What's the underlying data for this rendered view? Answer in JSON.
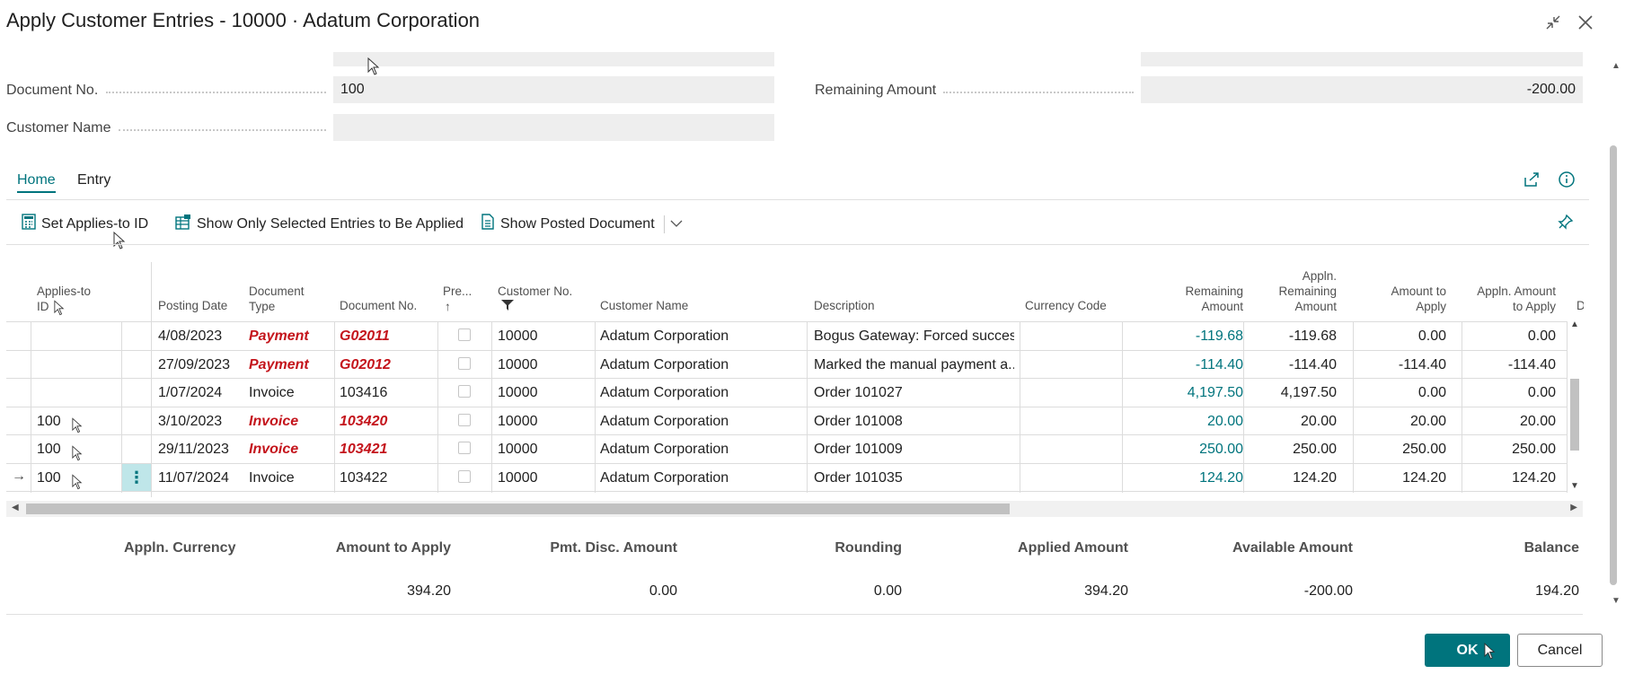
{
  "window": {
    "title": "Apply Customer Entries - 10000 · Adatum Corporation"
  },
  "header_fields": {
    "document_no_label": "Document No.",
    "document_no_value": "100",
    "customer_name_label": "Customer Name",
    "customer_name_value": "",
    "remaining_amount_label": "Remaining Amount",
    "remaining_amount_value": "-200.00"
  },
  "tabs": [
    {
      "label": "Home",
      "active": true
    },
    {
      "label": "Entry",
      "active": false
    }
  ],
  "actions": {
    "set_applies_to_id": "Set Applies-to ID",
    "show_only_selected": "Show Only Selected Entries to Be Applied",
    "show_posted_document": "Show Posted Document"
  },
  "columns": {
    "applies_to_id": [
      "Applies-to",
      "ID"
    ],
    "posting_date": "Posting Date",
    "document_type": [
      "Document",
      "Type"
    ],
    "document_no": "Document No.",
    "pre": "Pre...",
    "customer_no": "Customer No.",
    "customer_name": "Customer Name",
    "description": "Description",
    "currency_code": "Currency Code",
    "remaining_amount": [
      "Remaining",
      "Amount"
    ],
    "appln_remaining_amount": [
      "Appln.",
      "Remaining",
      "Amount"
    ],
    "amount_to_apply": [
      "Amount to",
      "Apply"
    ],
    "appln_amount_to_apply": [
      "Appln. Amount",
      "to Apply"
    ],
    "d": "D"
  },
  "rows": [
    {
      "applies_to_id": "",
      "posting_date": "4/08/2023",
      "document_type": "Payment",
      "document_no": "G02011",
      "customer_no": "10000",
      "customer_name": "Adatum Corporation",
      "description": "Bogus Gateway: Forced success",
      "currency_code": "",
      "remaining_amount": "-119.68",
      "appln_remaining_amount": "-119.68",
      "amount_to_apply": "0.00",
      "appln_amount_to_apply": "0.00",
      "highlight": true
    },
    {
      "applies_to_id": "",
      "posting_date": "27/09/2023",
      "document_type": "Payment",
      "document_no": "G02012",
      "customer_no": "10000",
      "customer_name": "Adatum Corporation",
      "description": "Marked the manual payment a...",
      "currency_code": "",
      "remaining_amount": "-114.40",
      "appln_remaining_amount": "-114.40",
      "amount_to_apply": "-114.40",
      "appln_amount_to_apply": "-114.40",
      "highlight": true
    },
    {
      "applies_to_id": "",
      "posting_date": "1/07/2024",
      "document_type": "Invoice",
      "document_no": "103416",
      "customer_no": "10000",
      "customer_name": "Adatum Corporation",
      "description": "Order 101027",
      "currency_code": "",
      "remaining_amount": "4,197.50",
      "appln_remaining_amount": "4,197.50",
      "amount_to_apply": "0.00",
      "appln_amount_to_apply": "0.00",
      "highlight": false
    },
    {
      "applies_to_id": "100",
      "posting_date": "3/10/2023",
      "document_type": "Invoice",
      "document_no": "103420",
      "customer_no": "10000",
      "customer_name": "Adatum Corporation",
      "description": "Order 101008",
      "currency_code": "",
      "remaining_amount": "20.00",
      "appln_remaining_amount": "20.00",
      "amount_to_apply": "20.00",
      "appln_amount_to_apply": "20.00",
      "highlight": true
    },
    {
      "applies_to_id": "100",
      "posting_date": "29/11/2023",
      "document_type": "Invoice",
      "document_no": "103421",
      "customer_no": "10000",
      "customer_name": "Adatum Corporation",
      "description": "Order 101009",
      "currency_code": "",
      "remaining_amount": "250.00",
      "appln_remaining_amount": "250.00",
      "amount_to_apply": "250.00",
      "appln_amount_to_apply": "250.00",
      "highlight": true
    },
    {
      "applies_to_id": "100",
      "posting_date": "11/07/2024",
      "document_type": "Invoice",
      "document_no": "103422",
      "customer_no": "10000",
      "customer_name": "Adatum Corporation",
      "description": "Order 101035",
      "currency_code": "",
      "remaining_amount": "124.20",
      "appln_remaining_amount": "124.20",
      "amount_to_apply": "124.20",
      "appln_amount_to_apply": "124.20",
      "highlight": false
    }
  ],
  "summary": {
    "labels": [
      "Appln. Currency",
      "Amount to Apply",
      "Pmt. Disc. Amount",
      "Rounding",
      "Applied Amount",
      "Available Amount",
      "Balance"
    ],
    "values": [
      "",
      "394.20",
      "0.00",
      "0.00",
      "394.20",
      "-200.00",
      "194.20"
    ]
  },
  "buttons": {
    "ok": "OK",
    "cancel": "Cancel"
  },
  "colors": {
    "accent": "#00747d",
    "highlight_red": "#c4151c"
  }
}
